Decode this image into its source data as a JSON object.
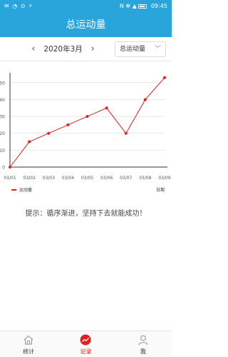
{
  "status_bar": {
    "left_icons": "✉ ◔ ⊙ ⚡",
    "right_icons": "N ✻ ▲",
    "battery": "",
    "time": "09:45"
  },
  "header": {
    "title": "总运动量"
  },
  "toolbar": {
    "prev_icon": "chevron-left-icon",
    "next_icon": "chevron-right-icon",
    "month": "2020年3月",
    "type_select": {
      "value": "总运动量",
      "caret": "﹀"
    }
  },
  "chart_data": {
    "type": "line",
    "x": [
      "03/01",
      "03/02",
      "03/03",
      "03/04",
      "03/05",
      "03/06",
      "03/07",
      "03/08",
      "03/09"
    ],
    "series": [
      {
        "name": "运动量",
        "values": [
          0,
          15,
          20,
          25,
          30,
          35,
          20,
          40,
          53
        ],
        "color": "#e02020"
      }
    ],
    "yticks": [
      0,
      10,
      20,
      30,
      40,
      50
    ],
    "ylim": [
      0,
      55
    ],
    "xlabel": "日期",
    "ylabel": "",
    "grid": true,
    "legend": "bottom-left"
  },
  "tip": "提示：循序渐进，坚持下去就能成功！",
  "tabbar": {
    "items": [
      {
        "label": "统计",
        "icon": "home-icon"
      },
      {
        "label": "记录",
        "icon": "chart-record-icon",
        "active": true
      },
      {
        "label": "我",
        "icon": "person-icon"
      }
    ]
  },
  "colors": {
    "primary": "#2aa5dc",
    "accent": "#e02020"
  }
}
